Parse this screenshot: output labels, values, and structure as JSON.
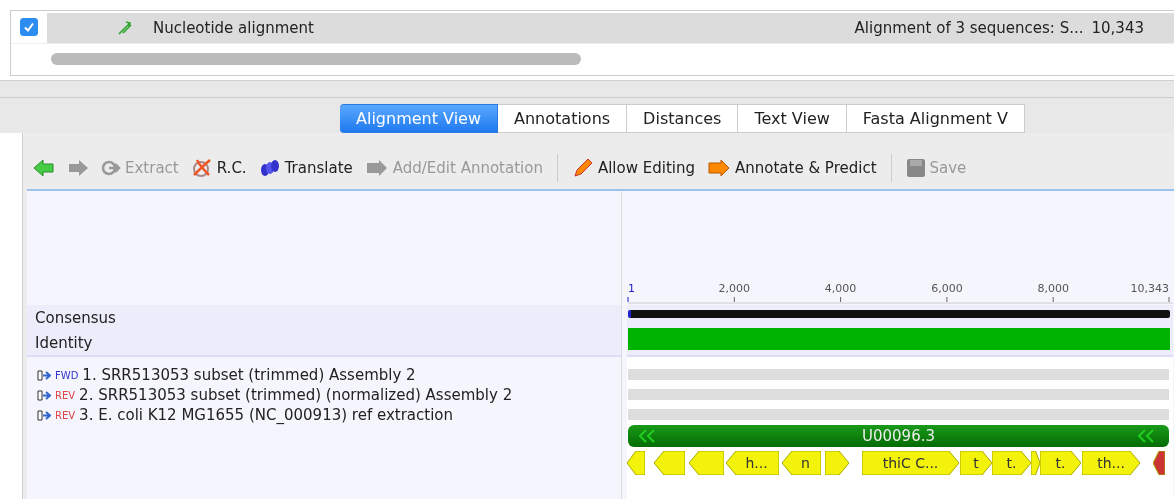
{
  "document_row": {
    "checked": true,
    "name": "Nucleotide alignment",
    "description": "Alignment of 3 sequences: S...",
    "length": "10,343"
  },
  "tabs": [
    {
      "label": "Alignment View",
      "selected": true
    },
    {
      "label": "Annotations",
      "selected": false
    },
    {
      "label": "Distances",
      "selected": false
    },
    {
      "label": "Text View",
      "selected": false
    },
    {
      "label": "Fasta Alignment V",
      "selected": false
    }
  ],
  "toolbar": [
    {
      "kind": "back",
      "disabled": false
    },
    {
      "kind": "forward",
      "disabled": true
    },
    {
      "kind": "extract",
      "label": "Extract",
      "disabled": true
    },
    {
      "kind": "rc",
      "label": "R.C.",
      "disabled": false
    },
    {
      "kind": "translate",
      "label": "Translate",
      "disabled": false
    },
    {
      "kind": "annotate",
      "label": "Add/Edit Annotation",
      "disabled": true
    },
    {
      "kind": "separator"
    },
    {
      "kind": "edit",
      "label": "Allow Editing",
      "disabled": false
    },
    {
      "kind": "predict",
      "label": "Annotate & Predict",
      "disabled": false
    },
    {
      "kind": "separator"
    },
    {
      "kind": "save",
      "label": "Save",
      "disabled": true
    }
  ],
  "ruler": {
    "ticks": [
      "1",
      "2,000",
      "4,000",
      "6,000",
      "8,000",
      "10,343"
    ]
  },
  "consensus": {
    "label": "Consensus"
  },
  "identity": {
    "label": "Identity",
    "level": 1
  },
  "sequences": [
    {
      "strand": "FWD",
      "name": "1. SRR513053 subset (trimmed) Assembly 2"
    },
    {
      "strand": "REV",
      "name": "2. SRR513053 subset (trimmed) (normalized) Assembly 2"
    },
    {
      "strand": "REV",
      "name": "3. E. coli K12 MG1655 (NC_000913) ref extraction"
    }
  ],
  "source_annotation": {
    "label": "U00096.3"
  },
  "genes": [
    {
      "reverse": true
    },
    {
      "reverse": true
    },
    {
      "reverse": true
    },
    {
      "reverse": true,
      "label": "h..."
    },
    {
      "reverse": true,
      "label": "n"
    },
    {
      "reverse": false
    },
    {
      "reverse": false,
      "label": "thiC C..."
    },
    {
      "reverse": false,
      "label": "t"
    },
    {
      "reverse": false,
      "label": "t."
    },
    {
      "reverse": false
    },
    {
      "reverse": false,
      "label": "t."
    },
    {
      "reverse": false,
      "label": "th..."
    },
    {
      "reverse": true,
      "kind": "other"
    }
  ]
}
